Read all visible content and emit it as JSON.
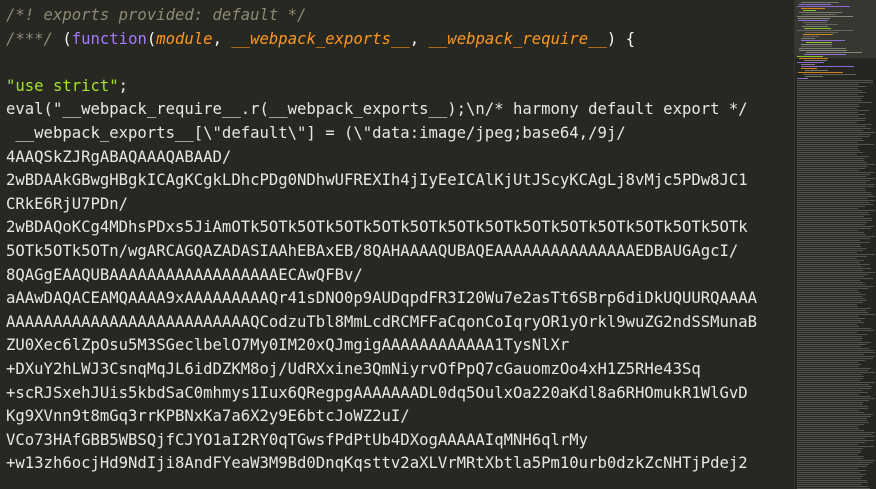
{
  "colors": {
    "background": "#272822",
    "comment": "#8f8a74",
    "keyword": "#a678ff",
    "param": "#fd971f",
    "string": "#a6e22e",
    "text": "#f8f8f2"
  },
  "code": {
    "line0": "/*! exports provided: default */",
    "line1": {
      "comment": "/***/",
      "open": " (",
      "fn": "function",
      "p1": "module",
      "p2": "__webpack_exports__",
      "p3": "__webpack_require__",
      "close": ") {"
    },
    "line3": {
      "str": "\"use strict\"",
      "tail": ";"
    },
    "lines": [
      "eval(\"__webpack_require__.r(__webpack_exports__);\\n/* harmony default export */",
      " __webpack_exports__[\\\"default\\\"] = (\\\"data:image/jpeg;base64,/9j/",
      "4AAQSkZJRgABAQAAAQABAAD/",
      "2wBDAAkGBwgHBgkICAgKCgkLDhcPDg0NDhwUFREXIh4jIyEeICAlKjUtJScyKCAgLj8vMjc5PDw8JC1",
      "CRkE6RjU7PDn/",
      "2wBDAQoKCg4MDhsPDxs5JiAmOTk5OTk5OTk5OTk5OTk5OTk5OTk5OTk5OTk5OTk5OTk5OTk5OTk5OTk",
      "5OTk5OTk5OTn/wgARCAGQAZADASIAAhEBAxEB/8QAHAAAAQUBAQEAAAAAAAAAAAAAAAEDBAUGAgcI/",
      "8QAGgEAAQUBAAAAAAAAAAAAAAAAAAECAwQFBv/",
      "aAAwDAQACEAMQAAAA9xAAAAAAAAAQr41sDNO0p9AUDqpdFR3I20Wu7e2asTt6SBrp6diDkUQUURQAAAA",
      "AAAAAAAAAAAAAAAAAAAAAAAAAAQCodzuTbl8MmLcdRCMFFaCqonCoIqryOR1yOrkl9wuZG2ndSSMunaB",
      "ZU0Xec6lZpOsu5M3SGeclbelO7My0IM20xQJmgigAAAAAAAAAAAA1TysNlXr",
      "+DXuY2hLWJ3CsnqMqJL6idDZKM8oj/UdRXxine3QmNiyrvOfPpQ7cGauomzOo4xH1Z5RHe43Sq",
      "+scRJSxehJUis5kbdSaC0mhmys1Iux6QRegpgAAAAAAADL0dq5OulxOa220aKdl8a6RHOmukR1WlGvD",
      "Kg9XVnn9t8mGq3rrKPBNxKa7a6X2y9E6btcJoWZ2uI/",
      "VCo73HAfGBB5WBSQjfCJYO1aI2RY0qTGwsfPdPtUb4DXogAAAAAIqMNH6qlrMy",
      "+w13zh6ocjHd9NdIji8AndFYeaW3M9Bd0DnqKqsttv2aXLVrMRtXbtla5Pm10urb0dzkZcNHTjPdej2"
    ]
  }
}
